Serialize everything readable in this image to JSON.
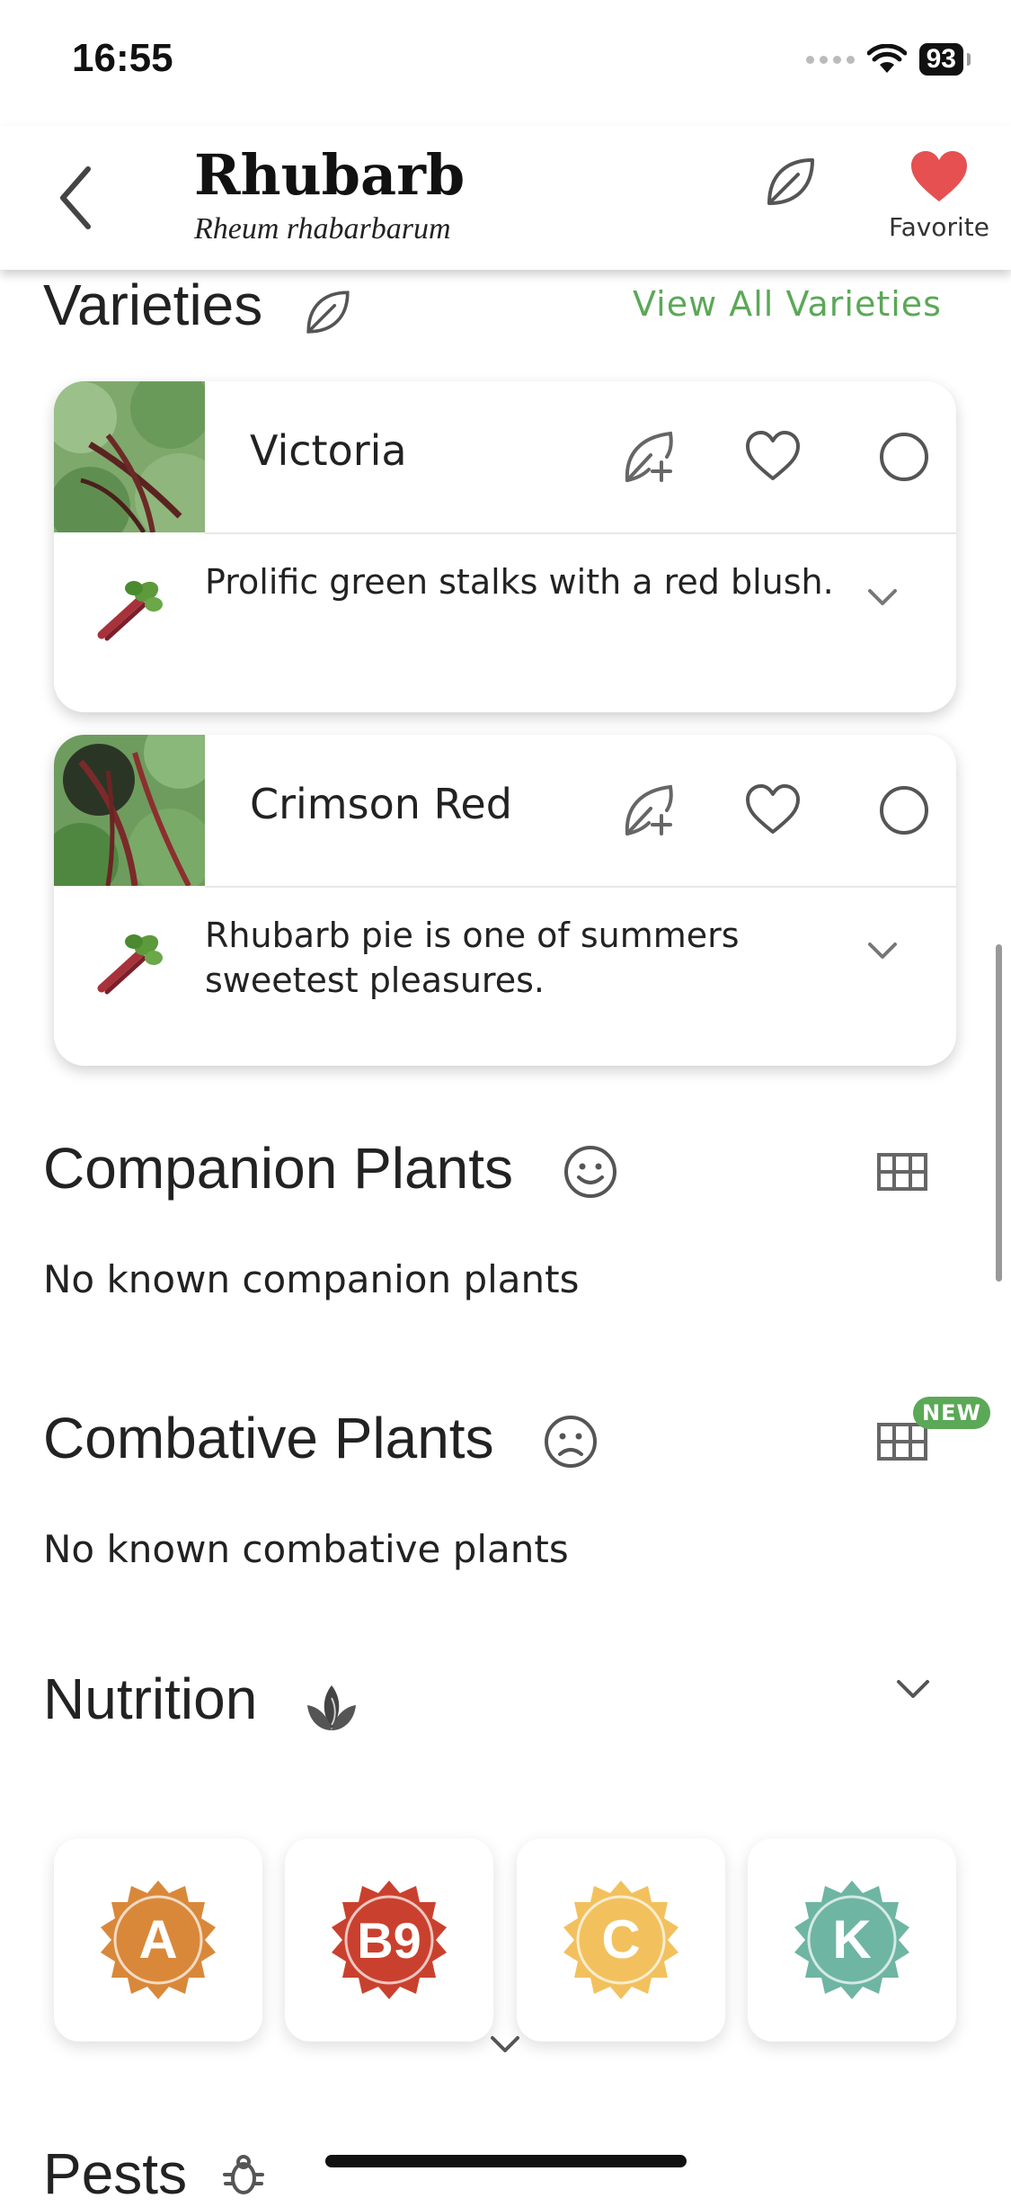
{
  "status": {
    "time": "16:55",
    "battery": "93"
  },
  "header": {
    "title": "Rhubarb",
    "subtitle": "Rheum rhabarbarum",
    "favorite_label": "Favorite"
  },
  "varieties": {
    "title": "Varieties",
    "view_all": "View All Varieties",
    "items": [
      {
        "name": "Victoria",
        "description": "Prolific green stalks with a red blush."
      },
      {
        "name": "Crimson Red",
        "description": "Rhubarb pie is one of summers sweetest pleasures."
      }
    ]
  },
  "companion": {
    "title": "Companion Plants",
    "empty": "No known companion plants"
  },
  "combative": {
    "title": "Combative Plants",
    "empty": "No known combative plants",
    "badge": "NEW"
  },
  "nutrition": {
    "title": "Nutrition",
    "vitamins": [
      {
        "label": "A",
        "color": "#d9883a"
      },
      {
        "label": "B9",
        "color": "#c9412e"
      },
      {
        "label": "C",
        "color": "#f2c15e"
      },
      {
        "label": "K",
        "color": "#6fb5a3"
      }
    ]
  },
  "pests": {
    "title": "Pests"
  },
  "colors": {
    "accent_green": "#5ba857",
    "heart_red": "#e65050"
  }
}
